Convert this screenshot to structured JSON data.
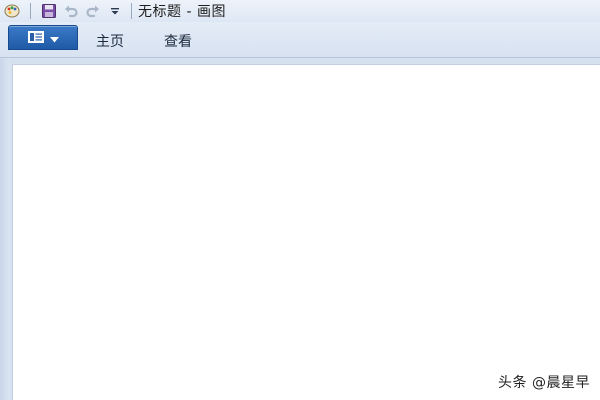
{
  "titlebar": {
    "title": "无标题 - 画图",
    "quick_access": [
      {
        "icon": "paint-app-icon"
      },
      {
        "icon": "save-icon"
      },
      {
        "icon": "undo-icon"
      },
      {
        "icon": "redo-icon"
      },
      {
        "icon": "customize-dropdown-icon"
      }
    ]
  },
  "ribbon": {
    "app_menu_icon": "paint-menu-icon",
    "tabs": [
      {
        "label": "主页"
      },
      {
        "label": "查看"
      }
    ]
  },
  "watermark": {
    "text": "头条 @晨星早"
  },
  "colors": {
    "app_menu_blue": "#1f5aa6",
    "ribbon_bg": "#dde7f4",
    "canvas_bg": "#ffffff"
  }
}
